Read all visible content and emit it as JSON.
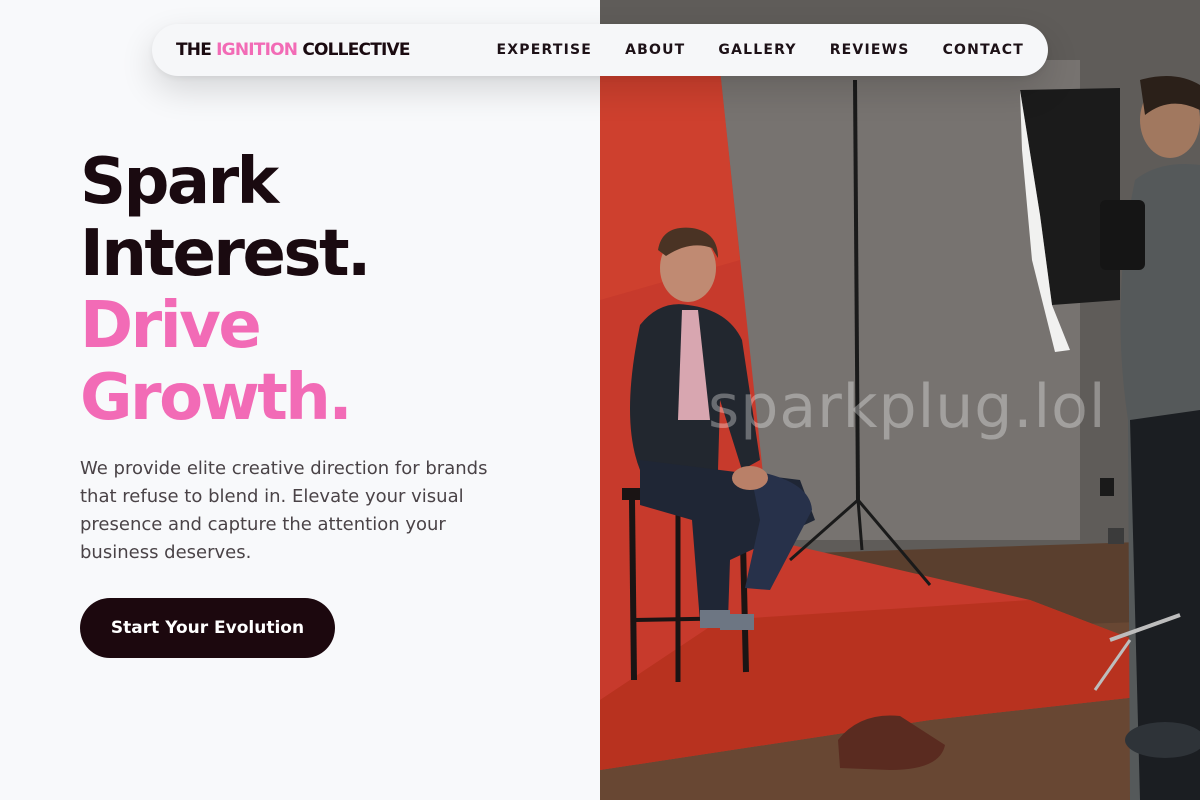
{
  "brand": {
    "part1": "THE ",
    "accent": "IGNITION",
    "part2": " COLLECTIVE"
  },
  "nav": {
    "items": [
      "EXPERTISE",
      "ABOUT",
      "GALLERY",
      "REVIEWS",
      "CONTACT"
    ]
  },
  "hero": {
    "line1": "Spark",
    "line2": "Interest.",
    "line3": "Drive",
    "line4": "Growth.",
    "description": "We provide elite creative direction for brands that refuse to blend in. Elevate your visual presence and capture the attention your business deserves.",
    "cta": "Start Your Evolution"
  },
  "image": {
    "watermark": "sparkplug.lol"
  },
  "colors": {
    "accent": "#f26bb6",
    "dark": "#1c080e",
    "background": "#f8f9fb"
  }
}
